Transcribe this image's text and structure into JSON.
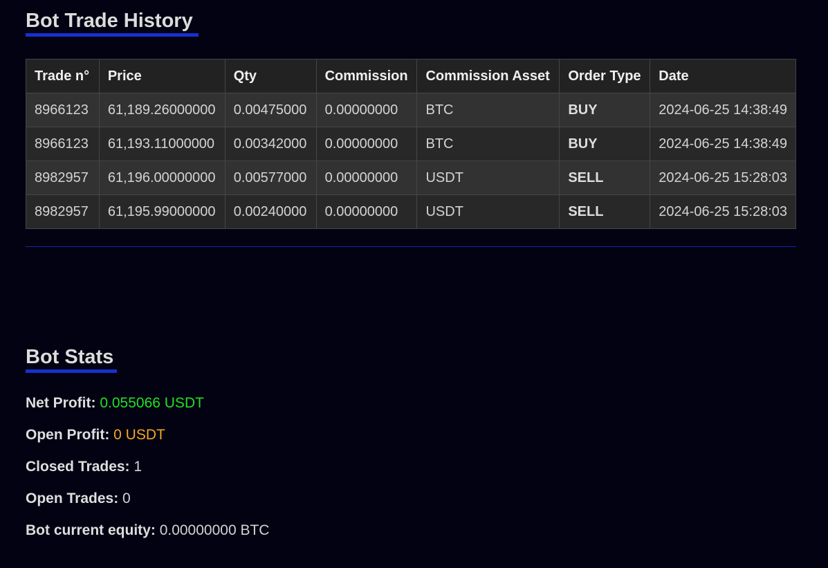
{
  "trade_history": {
    "title": "Bot Trade History",
    "columns": [
      "Trade n°",
      "Price",
      "Qty",
      "Commission",
      "Commission Asset",
      "Order Type",
      "Date"
    ],
    "rows": [
      [
        "8966123",
        "61,189.26000000",
        "0.00475000",
        "0.00000000",
        "BTC",
        "BUY",
        "2024-06-25 14:38:49"
      ],
      [
        "8966123",
        "61,193.11000000",
        "0.00342000",
        "0.00000000",
        "BTC",
        "BUY",
        "2024-06-25 14:38:49"
      ],
      [
        "8982957",
        "61,196.00000000",
        "0.00577000",
        "0.00000000",
        "USDT",
        "SELL",
        "2024-06-25 15:28:03"
      ],
      [
        "8982957",
        "61,195.99000000",
        "0.00240000",
        "0.00000000",
        "USDT",
        "SELL",
        "2024-06-25 15:28:03"
      ]
    ]
  },
  "stats": {
    "title": "Bot Stats",
    "items": [
      {
        "label": "Net Profit:",
        "value": "0.055066 USDT",
        "color": "#22e022"
      },
      {
        "label": "Open Profit:",
        "value": "0 USDT",
        "color": "#f5a623"
      },
      {
        "label": "Closed Trades:",
        "value": "1"
      },
      {
        "label": "Open Trades:",
        "value": "0"
      },
      {
        "label": "Bot current equity:",
        "value": "0.00000000 BTC"
      }
    ]
  },
  "colors": {
    "background": "#020212",
    "accent_underline": "#1530d0",
    "profit_positive": "#22e022",
    "profit_neutral": "#f5a623"
  }
}
